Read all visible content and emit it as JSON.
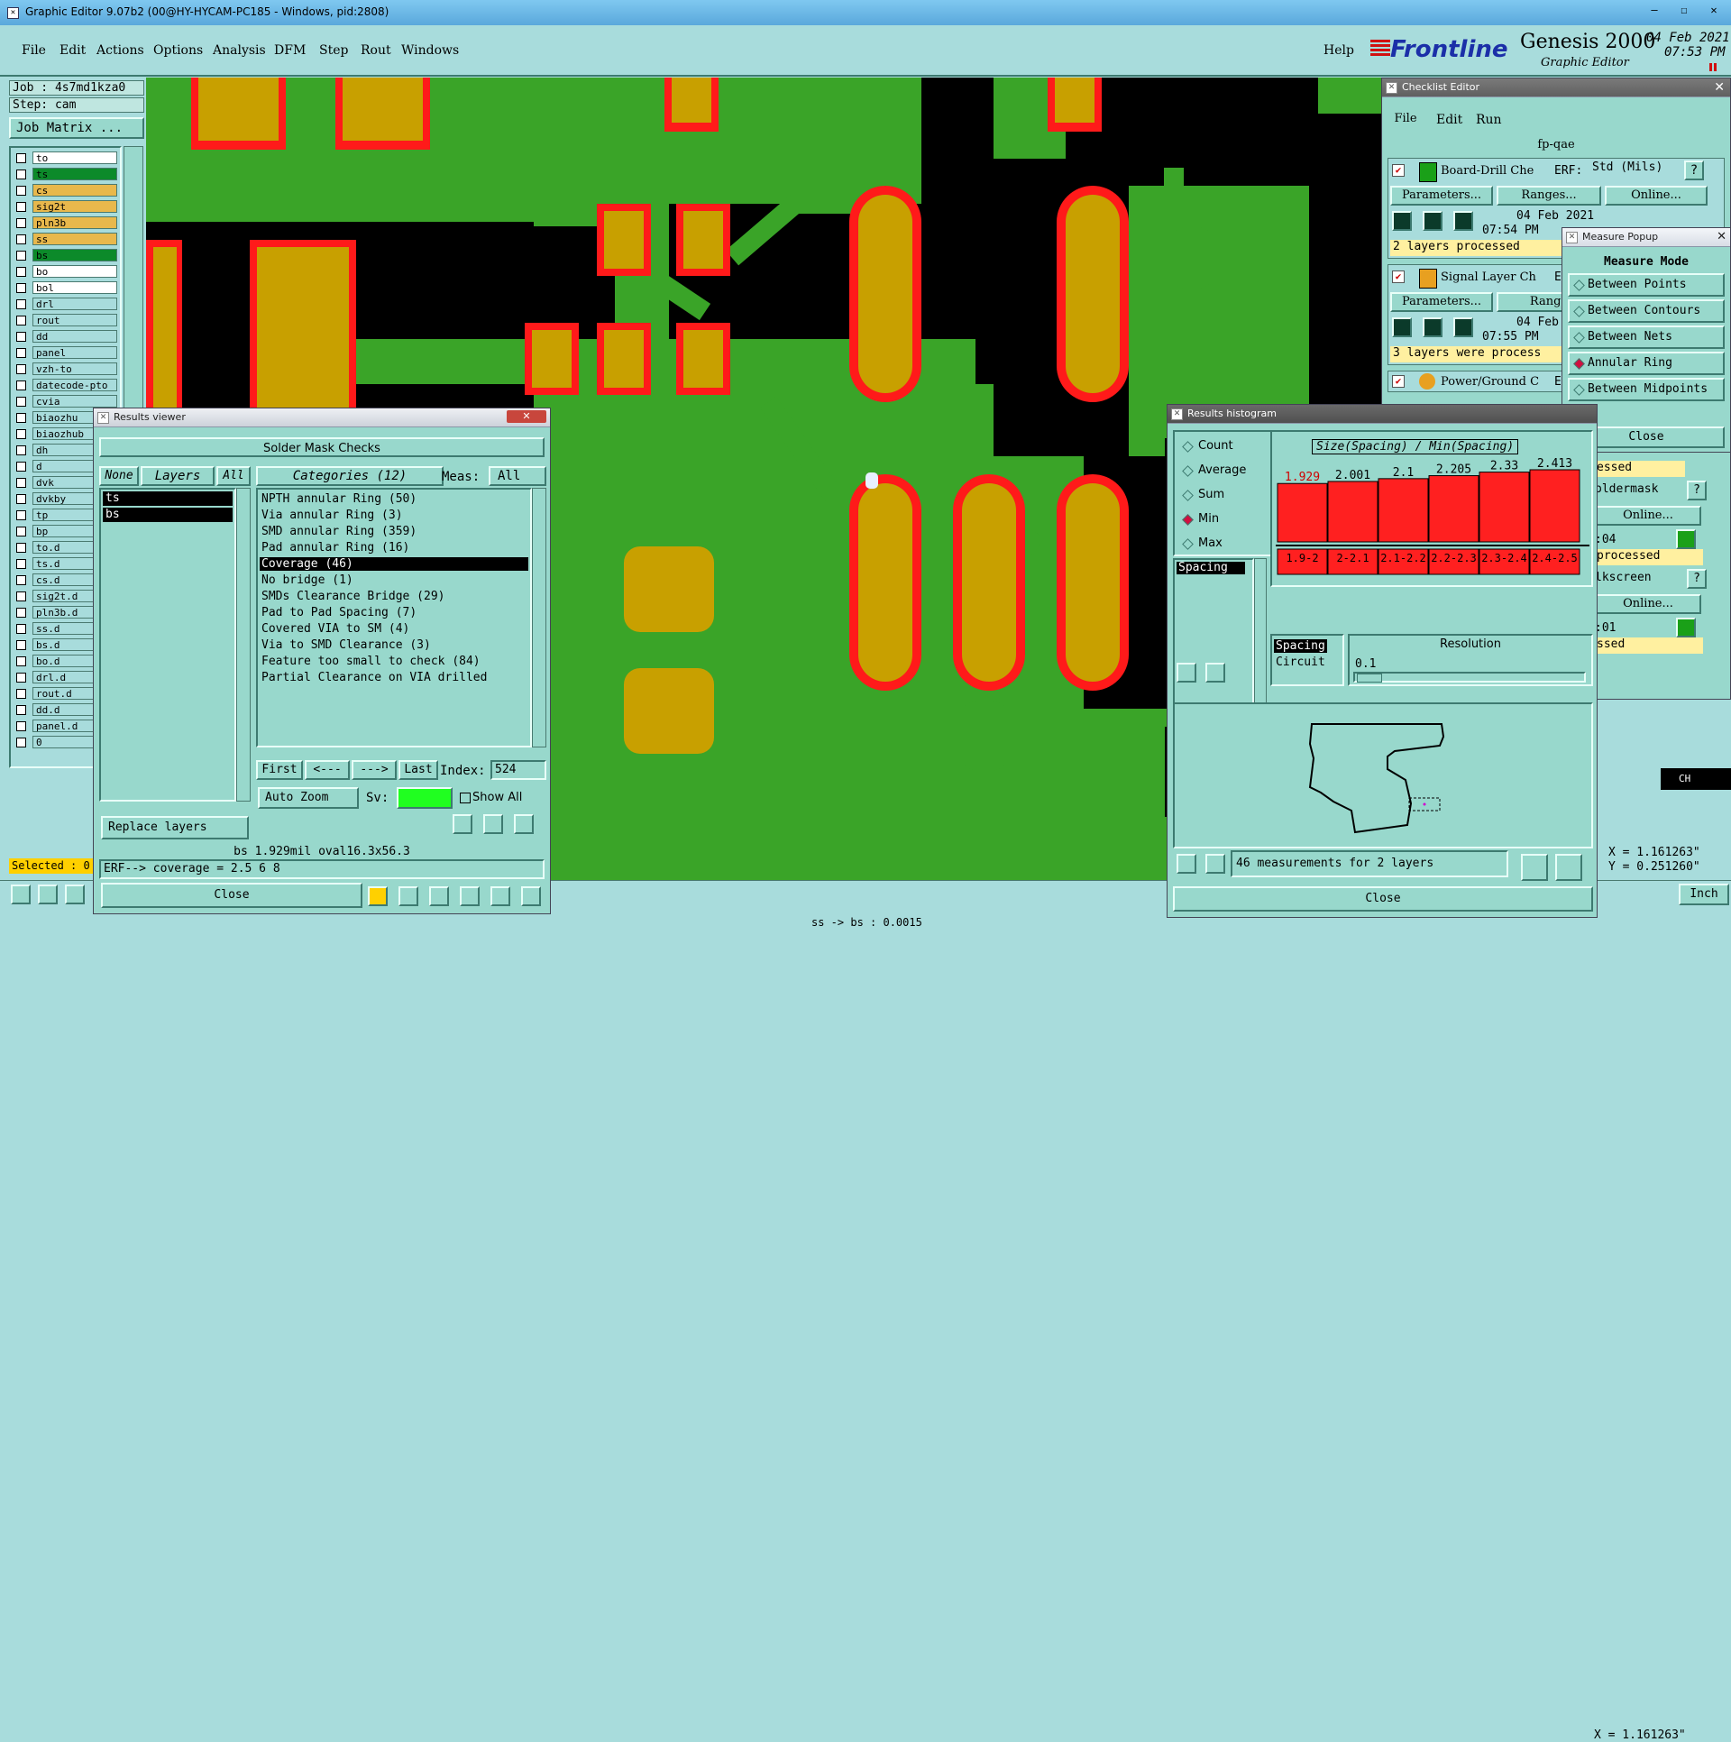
{
  "main_window": {
    "title": "Graphic Editor 9.07b2 (00@HY-HYCAM-PC185 - Windows, pid:2808)",
    "menu": [
      "File",
      "Edit",
      "Actions",
      "Options",
      "Analysis",
      "DFM",
      "Step",
      "Rout",
      "Windows"
    ],
    "help": "Help",
    "brand": "Frontline",
    "product": "Genesis 2000",
    "subtitle": "Graphic Editor",
    "date": "04 Feb 2021",
    "time": "07:53 PM"
  },
  "left_panel": {
    "job": "Job : 4s7md1kza0",
    "step": "Step: cam",
    "job_matrix": "Job Matrix ...",
    "layers": [
      {
        "name": "to",
        "color": "#ffffff"
      },
      {
        "name": "ts",
        "color": "#0c8a2a"
      },
      {
        "name": "cs",
        "color": "#e8b84c"
      },
      {
        "name": "sig2t",
        "color": "#e8b84c"
      },
      {
        "name": "pln3b",
        "color": "#e8b84c"
      },
      {
        "name": "ss",
        "color": "#e8b84c"
      },
      {
        "name": "bs",
        "color": "#0c8a2a"
      },
      {
        "name": "bo",
        "color": "#ffffff"
      },
      {
        "name": "bol",
        "color": "#ffffff"
      },
      {
        "name": "drl",
        "color": "#a8dcdc"
      },
      {
        "name": "rout",
        "color": "#a8dcdc"
      },
      {
        "name": "dd",
        "color": "#a8dcdc"
      },
      {
        "name": "panel",
        "color": "#a8dcdc"
      },
      {
        "name": "vzh-to",
        "color": "#a8dcdc"
      },
      {
        "name": "datecode-pto",
        "color": "#a8dcdc"
      },
      {
        "name": "cvia",
        "color": "#a8dcdc"
      },
      {
        "name": "biaozhu",
        "color": "#a8dcdc"
      },
      {
        "name": "biaozhub",
        "color": "#a8dcdc"
      },
      {
        "name": "dh",
        "color": "#a8dcdc"
      },
      {
        "name": "d",
        "color": "#a8dcdc"
      },
      {
        "name": "dvk",
        "color": "#a8dcdc"
      },
      {
        "name": "dvkby",
        "color": "#a8dcdc"
      },
      {
        "name": "tp",
        "color": "#a8dcdc"
      },
      {
        "name": "bp",
        "color": "#a8dcdc"
      },
      {
        "name": "to.d",
        "color": "#a8dcdc"
      },
      {
        "name": "ts.d",
        "color": "#a8dcdc"
      },
      {
        "name": "cs.d",
        "color": "#a8dcdc"
      },
      {
        "name": "sig2t.d",
        "color": "#a8dcdc"
      },
      {
        "name": "pln3b.d",
        "color": "#a8dcdc"
      },
      {
        "name": "ss.d",
        "color": "#a8dcdc"
      },
      {
        "name": "bs.d",
        "color": "#a8dcdc"
      },
      {
        "name": "bo.d",
        "color": "#a8dcdc"
      },
      {
        "name": "drl.d",
        "color": "#a8dcdc"
      },
      {
        "name": "rout.d",
        "color": "#a8dcdc"
      },
      {
        "name": "dd.d",
        "color": "#a8dcdc"
      },
      {
        "name": "panel.d",
        "color": "#a8dcdc"
      },
      {
        "name": "0",
        "color": "#a8dcdc"
      }
    ],
    "selected": "Selected : 0"
  },
  "results_viewer": {
    "title": "Results viewer",
    "header": "Solder Mask Checks",
    "none": "None",
    "layers": "Layers",
    "all": "All",
    "layer_items": [
      "ts",
      "bs"
    ],
    "categories": "Categories (12)",
    "meas_label": "Meas:",
    "meas_value": "All",
    "category_items": [
      "NPTH annular Ring (50)",
      "Via annular Ring (3)",
      "SMD annular Ring (359)",
      "Pad annular Ring (16)",
      "Coverage (46)",
      "No bridge (1)",
      "SMDs Clearance Bridge (29)",
      "Pad to Pad Spacing (7)",
      "Covered VIA to SM (4)",
      "Via to SMD Clearance (3)",
      "Feature too small to check (84)",
      "Partial Clearance on VIA drilled"
    ],
    "first": "First",
    "prev": "<---",
    "next": "--->",
    "last": "Last",
    "index_label": "Index:",
    "index_value": "524",
    "auto_zoom": "Auto Zoom",
    "sv": "Sv:",
    "show_all": "Show All",
    "replace_layers": "Replace layers",
    "status1": "bs 1.929mil   oval16.3x56.3",
    "status2": "ERF--> coverage = 2.5 6 8",
    "close": "Close"
  },
  "checklist_editor": {
    "title": "Checklist Editor",
    "menu": [
      "File",
      "Edit",
      "Run"
    ],
    "name": "fp-qae",
    "rows": [
      {
        "name": "Board-Drill Che",
        "erf": "ERF:",
        "erf_value": "Std (Mils)",
        "params": "Parameters...",
        "ranges": "Ranges...",
        "online": "Online...",
        "date": "04 Feb 2021",
        "time": "07:54 PM",
        "status": "2 layers processed"
      },
      {
        "name": "Signal Layer Ch",
        "erf": "ER",
        "params": "Parameters...",
        "ranges": "Range",
        "date": "04 Feb",
        "time": "07:55 PM",
        "status": "3 layers were process"
      },
      {
        "name": "Power/Ground C",
        "erf": "ER"
      }
    ],
    "partial": [
      "essed",
      "oldermask",
      "Online...",
      ":04",
      "processed",
      "lkscreen",
      "Online...",
      ":01",
      "ssed"
    ]
  },
  "measure_popup": {
    "title": "Measure Popup",
    "mode": "Measure Mode",
    "options": [
      "Between Points",
      "Between Contours",
      "Between Nets",
      "Annular Ring",
      "Between Midpoints"
    ],
    "selected": "Annular Ring",
    "close": "Close"
  },
  "histogram": {
    "title": "Results histogram",
    "modes": [
      "Count",
      "Average",
      "Sum",
      "Min",
      "Max"
    ],
    "selected_mode": "Min",
    "list_item": "Spacing",
    "chart_title": "Size(Spacing) / Min(Spacing)",
    "bars": [
      {
        "value": "1.929",
        "bin": "1.9-2"
      },
      {
        "value": "2.001",
        "bin": "2-2.1"
      },
      {
        "value": "2.1",
        "bin": "2.1-2.2"
      },
      {
        "value": "2.205",
        "bin": "2.2-2.3"
      },
      {
        "value": "2.33",
        "bin": "2.3-2.4"
      },
      {
        "value": "2.413",
        "bin": "2.4-2.5"
      }
    ],
    "type_options": [
      "Spacing",
      "Circuit"
    ],
    "resolution_label": "Resolution",
    "resolution_value": "0.1",
    "summary": "46 measurements for 2 layers",
    "close": "Close",
    "bar_color": "#ff2020"
  },
  "bottom": {
    "status": "ss -> bs : 0.0015",
    "coord_x": "X = 1.161263\"",
    "coord_y": "Y = 0.251260\"",
    "units": "Inch",
    "ime": "CH"
  },
  "colors": {
    "pcb_bg": "#000000",
    "copper": "#3aa428",
    "pad": "#c8a000",
    "mask": "#ff1a1a",
    "panel": "#a8dcdc"
  }
}
